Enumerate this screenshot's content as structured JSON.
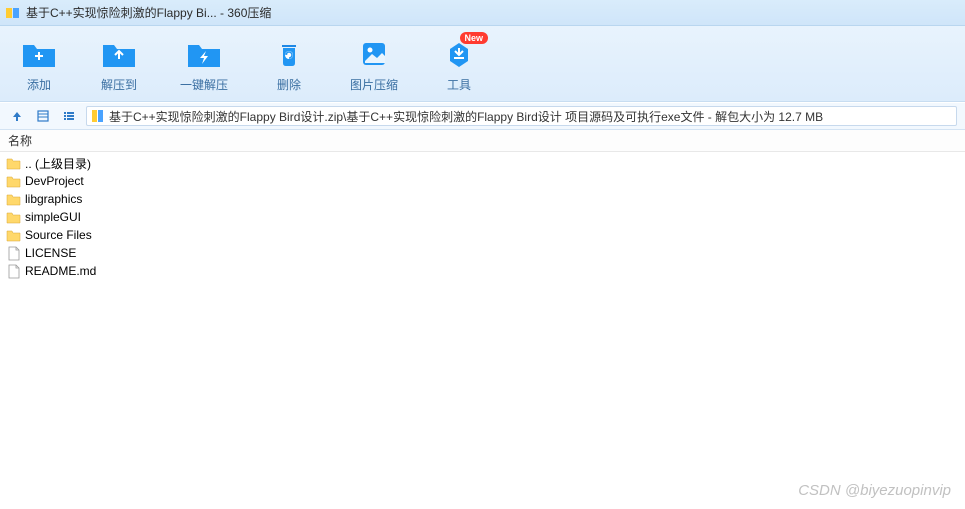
{
  "window": {
    "title": "基于C++实现惊险刺激的Flappy Bi... - 360压缩"
  },
  "toolbar": {
    "add": "添加",
    "extract_to": "解压到",
    "one_click_extract": "一键解压",
    "delete": "删除",
    "image_compress": "图片压缩",
    "tools": "工具",
    "badge_new": "New"
  },
  "path": {
    "text": "基于C++实现惊险刺激的Flappy Bird设计.zip\\基于C++实现惊险刺激的Flappy Bird设计 项目源码及可执行exe文件 - 解包大小为 12.7 MB"
  },
  "columns": {
    "name": "名称"
  },
  "files": [
    {
      "label": ".. (上级目录)",
      "type": "folder"
    },
    {
      "label": "DevProject",
      "type": "folder"
    },
    {
      "label": "libgraphics",
      "type": "folder"
    },
    {
      "label": "simpleGUI",
      "type": "folder"
    },
    {
      "label": "Source Files",
      "type": "folder"
    },
    {
      "label": "LICENSE",
      "type": "file"
    },
    {
      "label": "README.md",
      "type": "file"
    }
  ],
  "watermark": "CSDN @biyezuopinvip"
}
